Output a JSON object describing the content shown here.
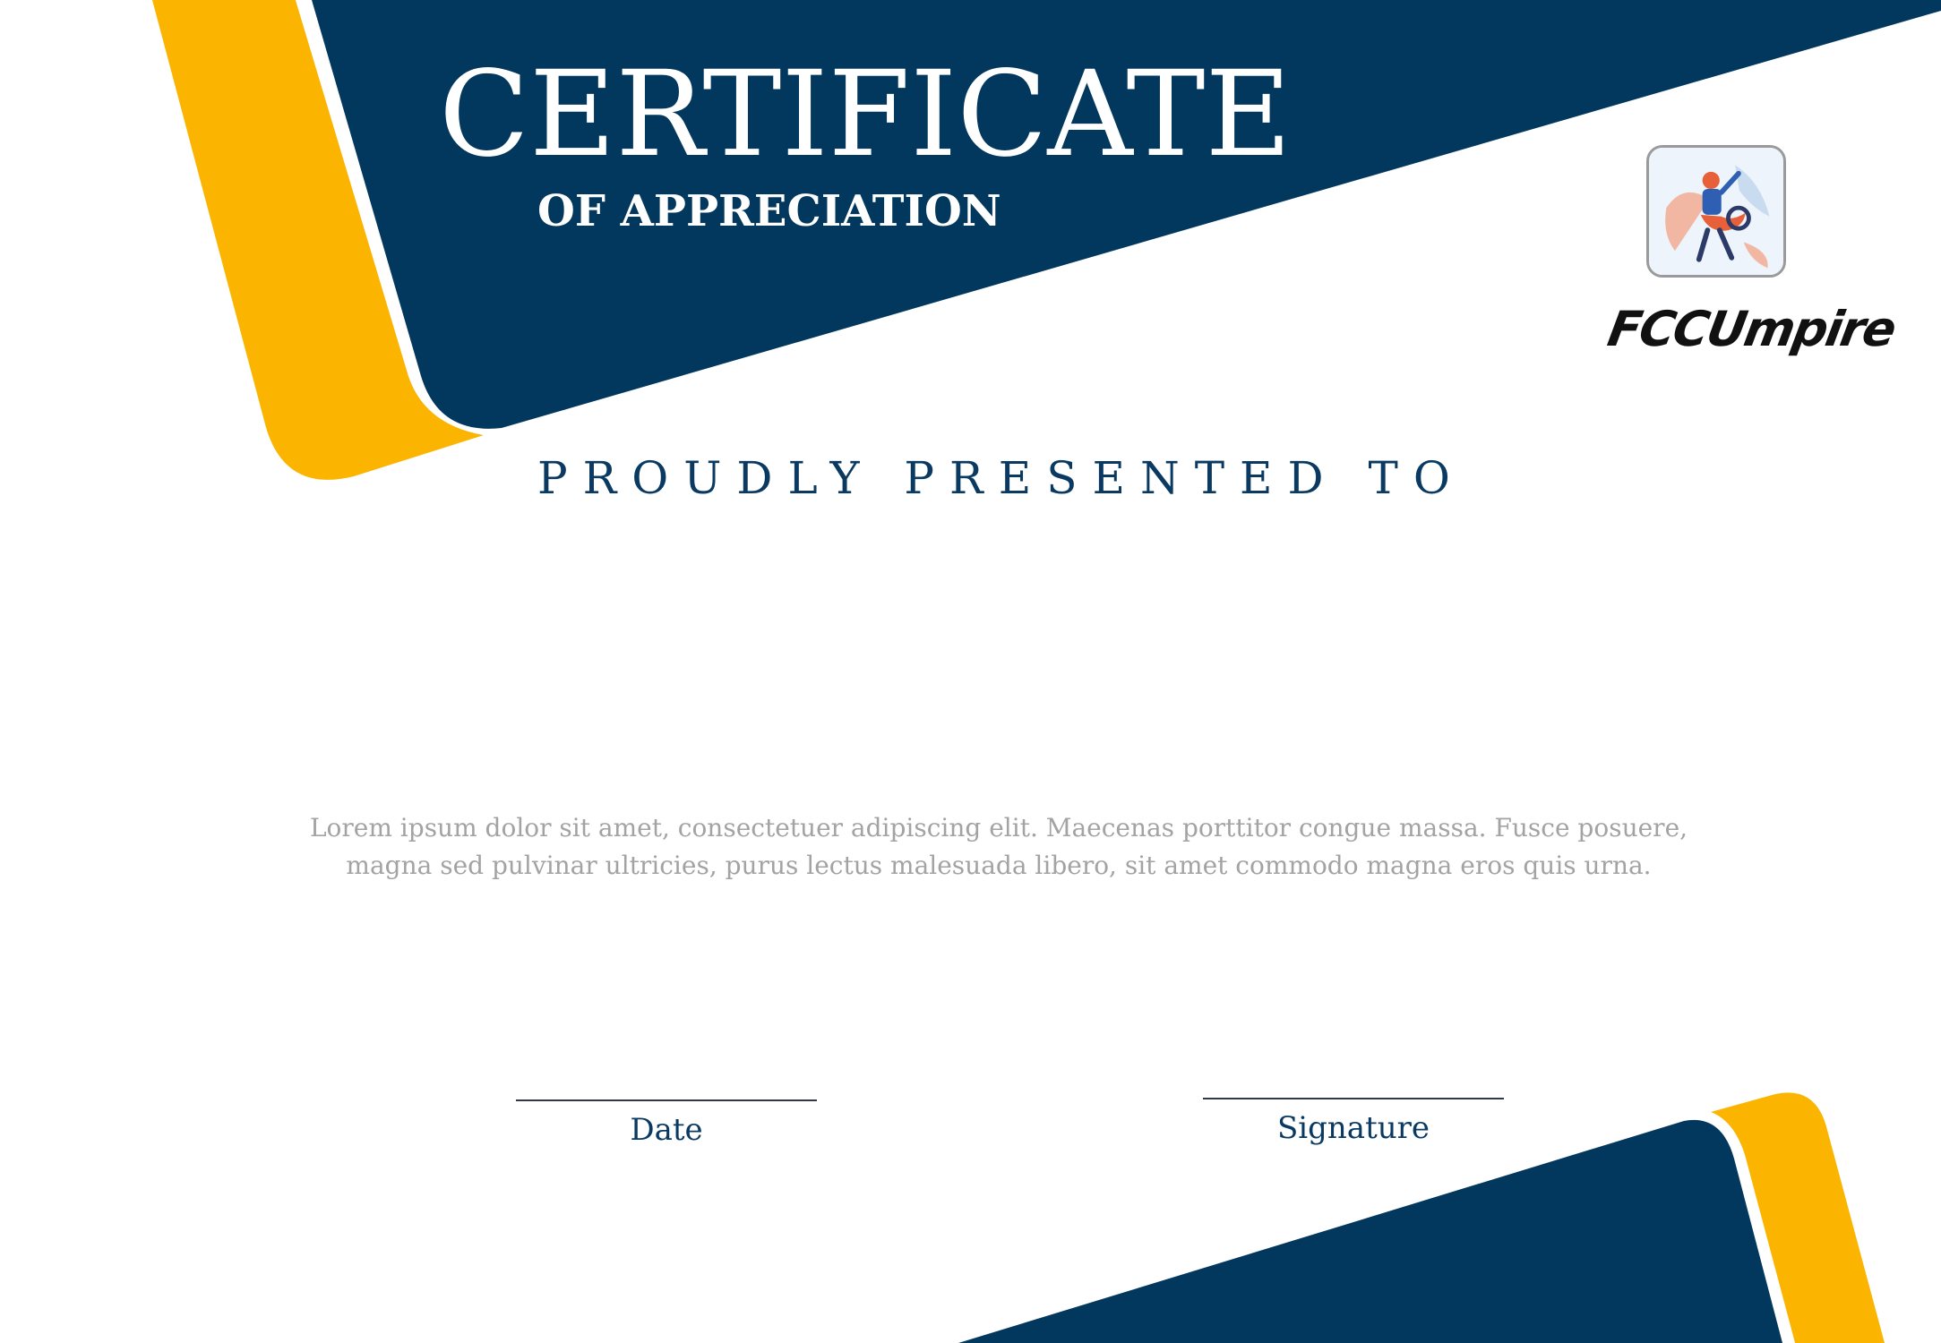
{
  "certificate": {
    "title": "CERTIFICATE",
    "subtitle": "OF APPRECIATION",
    "presented_to": "PROUDLY PRESENTED TO",
    "body_lines": [
      "Lorem ipsum dolor sit amet, consectetuer adipiscing elit. Maecenas porttitor congue massa. Fusce posuere,",
      "magna sed pulvinar ultricies, purus lectus malesuada libero, sit amet commodo magna eros quis urna."
    ],
    "date_label": "Date",
    "signature_label": "Signature"
  },
  "brand": {
    "name": "FCCUmpire",
    "logo_icon": "umpire-figure-icon"
  },
  "colors": {
    "navy": "#02375e",
    "gold": "#fbb400",
    "white": "#ffffff",
    "body_text": "#a3a3a3",
    "heading_text": "#0a3a62"
  }
}
